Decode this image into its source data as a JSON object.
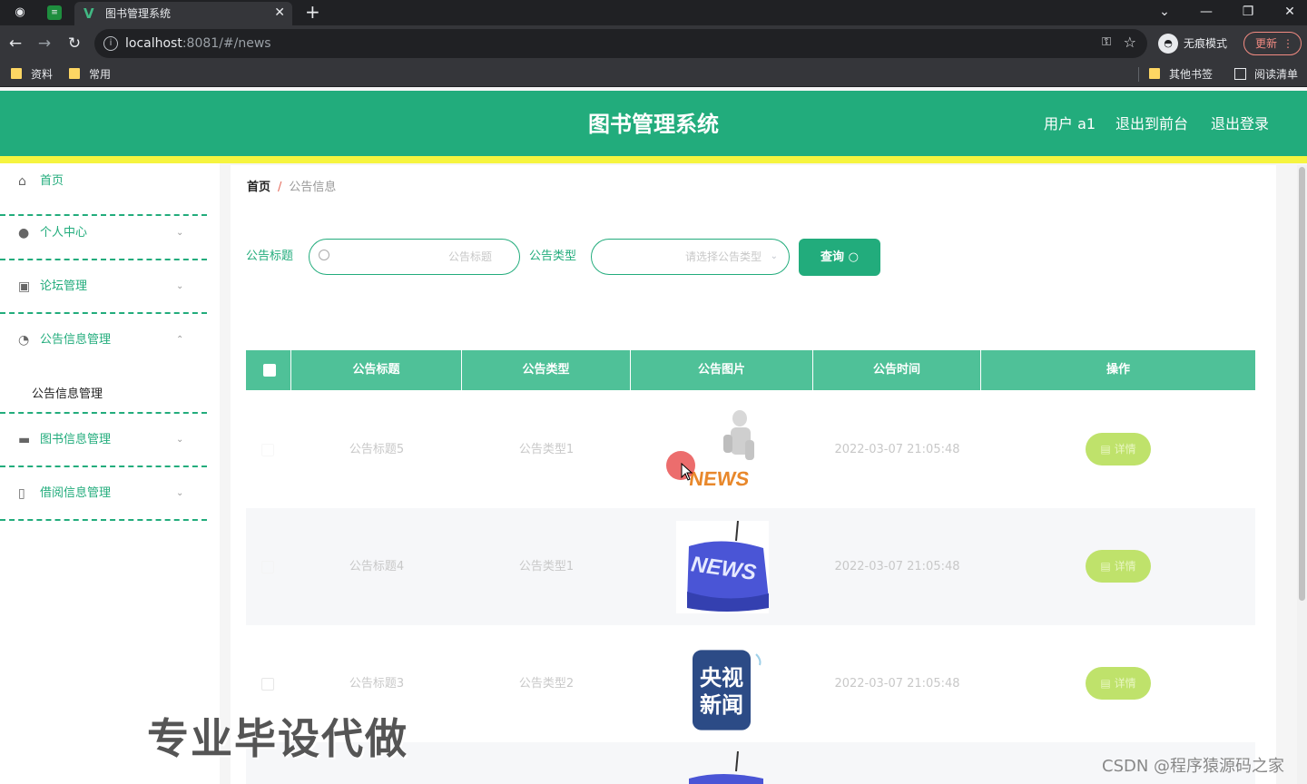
{
  "browser": {
    "tab_title": "图书管理系统",
    "url_host": "localhost",
    "url_rest": ":8081/#/news",
    "incognito_label": "无痕模式",
    "update_label": "更新",
    "bookmarks": [
      "资料",
      "常用"
    ],
    "other_bookmarks": "其他书签",
    "reading_list": "阅读清单"
  },
  "header": {
    "title": "图书管理系统",
    "user": "用户 a1",
    "to_front": "退出到前台",
    "logout": "退出登录",
    "color": "#22ac7c"
  },
  "sidebar": {
    "items": [
      {
        "label": "首页",
        "icon": "home-icon"
      },
      {
        "label": "个人中心",
        "icon": "user-icon"
      },
      {
        "label": "论坛管理",
        "icon": "forum-icon"
      },
      {
        "label": "公告信息管理",
        "icon": "notice-icon"
      },
      {
        "label": "图书信息管理",
        "icon": "monitor-icon"
      },
      {
        "label": "借阅信息管理",
        "icon": "phone-icon"
      }
    ],
    "submenu": "公告信息管理"
  },
  "breadcrumb": {
    "home": "首页",
    "sep": "/",
    "current": "公告信息"
  },
  "search": {
    "title_label": "公告标题",
    "title_placeholder": "公告标题",
    "type_label": "公告类型",
    "type_placeholder": "请选择公告类型",
    "query_label": "查询"
  },
  "table": {
    "headers": [
      "公告标题",
      "公告类型",
      "公告图片",
      "公告时间",
      "操作"
    ],
    "rows": [
      {
        "title": "公告标题5",
        "type": "公告类型1",
        "image": "news-3d-figure",
        "time": "2022-03-07 21:05:48",
        "action": "详情"
      },
      {
        "title": "公告标题4",
        "type": "公告类型1",
        "image": "news-key",
        "time": "2022-03-07 21:05:48",
        "action": "详情"
      },
      {
        "title": "公告标题3",
        "type": "公告类型2",
        "image": "cctv-news-logo",
        "time": "2022-03-07 21:05:48",
        "action": "详情"
      }
    ]
  },
  "images": {
    "key_text": "NEWS",
    "cctv_line1": "央视",
    "cctv_line2": "新闻",
    "figure_text": "NEWS"
  },
  "overlay": {
    "ad_text": "专业毕设代做",
    "csdn_text": "CSDN @程序猿源码之家"
  }
}
